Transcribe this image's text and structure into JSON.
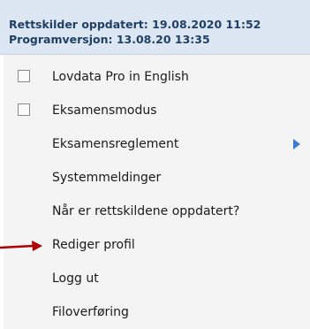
{
  "header": {
    "line1": "Rettskilder oppdatert: 19.08.2020 11:52",
    "line2": "Programversjon: 13.08.20 13:35"
  },
  "menu": {
    "items": [
      {
        "label": "Lovdata Pro in English",
        "has_checkbox": true,
        "checked": false
      },
      {
        "label": "Eksamensmodus",
        "has_checkbox": true,
        "checked": false
      },
      {
        "label": "Eksamensreglement",
        "has_submenu": true
      },
      {
        "label": "Systemmeldinger"
      },
      {
        "label": "Når er rettskildene oppdatert?"
      },
      {
        "label": "Rediger profil",
        "highlighted_by_arrow": true
      },
      {
        "label": "Logg ut"
      },
      {
        "label": "Filoverføring"
      }
    ]
  },
  "colors": {
    "header_bg": "#dde7f3",
    "header_text": "#1f3f66",
    "menu_bg": "#f4f4f4",
    "submenu_arrow": "#3c7bd6",
    "pointer_arrow": "#b00000"
  },
  "icons": {
    "submenu": "triangle-right-icon",
    "pointer": "red-arrow-icon"
  }
}
